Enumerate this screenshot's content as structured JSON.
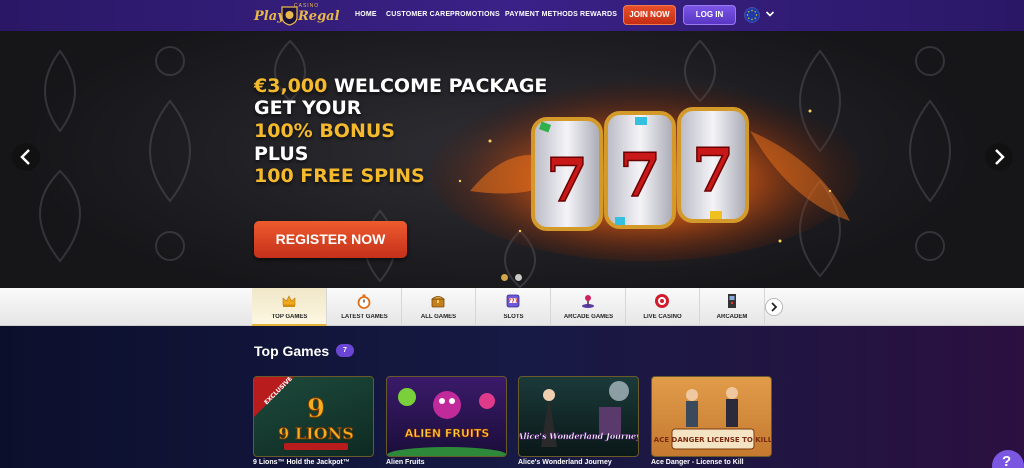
{
  "header": {
    "logo": {
      "word1": "Play",
      "word2": "Regal",
      "small": "CASINO"
    },
    "nav": [
      "HOME",
      "CUSTOMER CARE",
      "PROMOTIONS",
      "PAYMENT METHODS",
      "REWARDS"
    ],
    "join_label": "JOIN NOW",
    "login_label": "LOG IN",
    "language_icon": "eu-flag-icon"
  },
  "hero": {
    "line1_amount": "€3,000",
    "line1_rest": " WELCOME PACKAGE",
    "line2": "GET YOUR",
    "line3": "100% BONUS",
    "line4": "PLUS",
    "line5": "100 FREE SPINS",
    "cta_label": "REGISTER NOW",
    "slides_total": 2,
    "slide_active": 1
  },
  "tabs": [
    {
      "label": "TOP GAMES",
      "icon": "crown-icon"
    },
    {
      "label": "LATEST GAMES",
      "icon": "stopwatch-icon"
    },
    {
      "label": "ALL GAMES",
      "icon": "treasure-chest-icon"
    },
    {
      "label": "SLOTS",
      "icon": "slot-machine-icon"
    },
    {
      "label": "ARCADE GAMES",
      "icon": "joystick-icon"
    },
    {
      "label": "LIVE CASINO",
      "icon": "roulette-chip-icon"
    },
    {
      "label": "ARCADEM",
      "icon": "arcade-cabinet-icon"
    }
  ],
  "section": {
    "title": "Top Games",
    "count": "7"
  },
  "games": [
    {
      "title": "9 Lions™ Hold the Jackpot™",
      "art_text": "9 LIONS",
      "ribbon": "EXCLUSIVE"
    },
    {
      "title": "Alien Fruits",
      "art_text": "ALIEN FRUITS"
    },
    {
      "title": "Alice's Wonderland Journey",
      "art_text": "Alice's Wonderland Journey"
    },
    {
      "title": "Ace Danger - License to Kill",
      "art_text": "ACE DANGER LICENSE TO KILL"
    }
  ],
  "colors": {
    "accent_purple": "#6b46d6",
    "join_orange": "#e8502a",
    "gold": "#f5b92c"
  }
}
